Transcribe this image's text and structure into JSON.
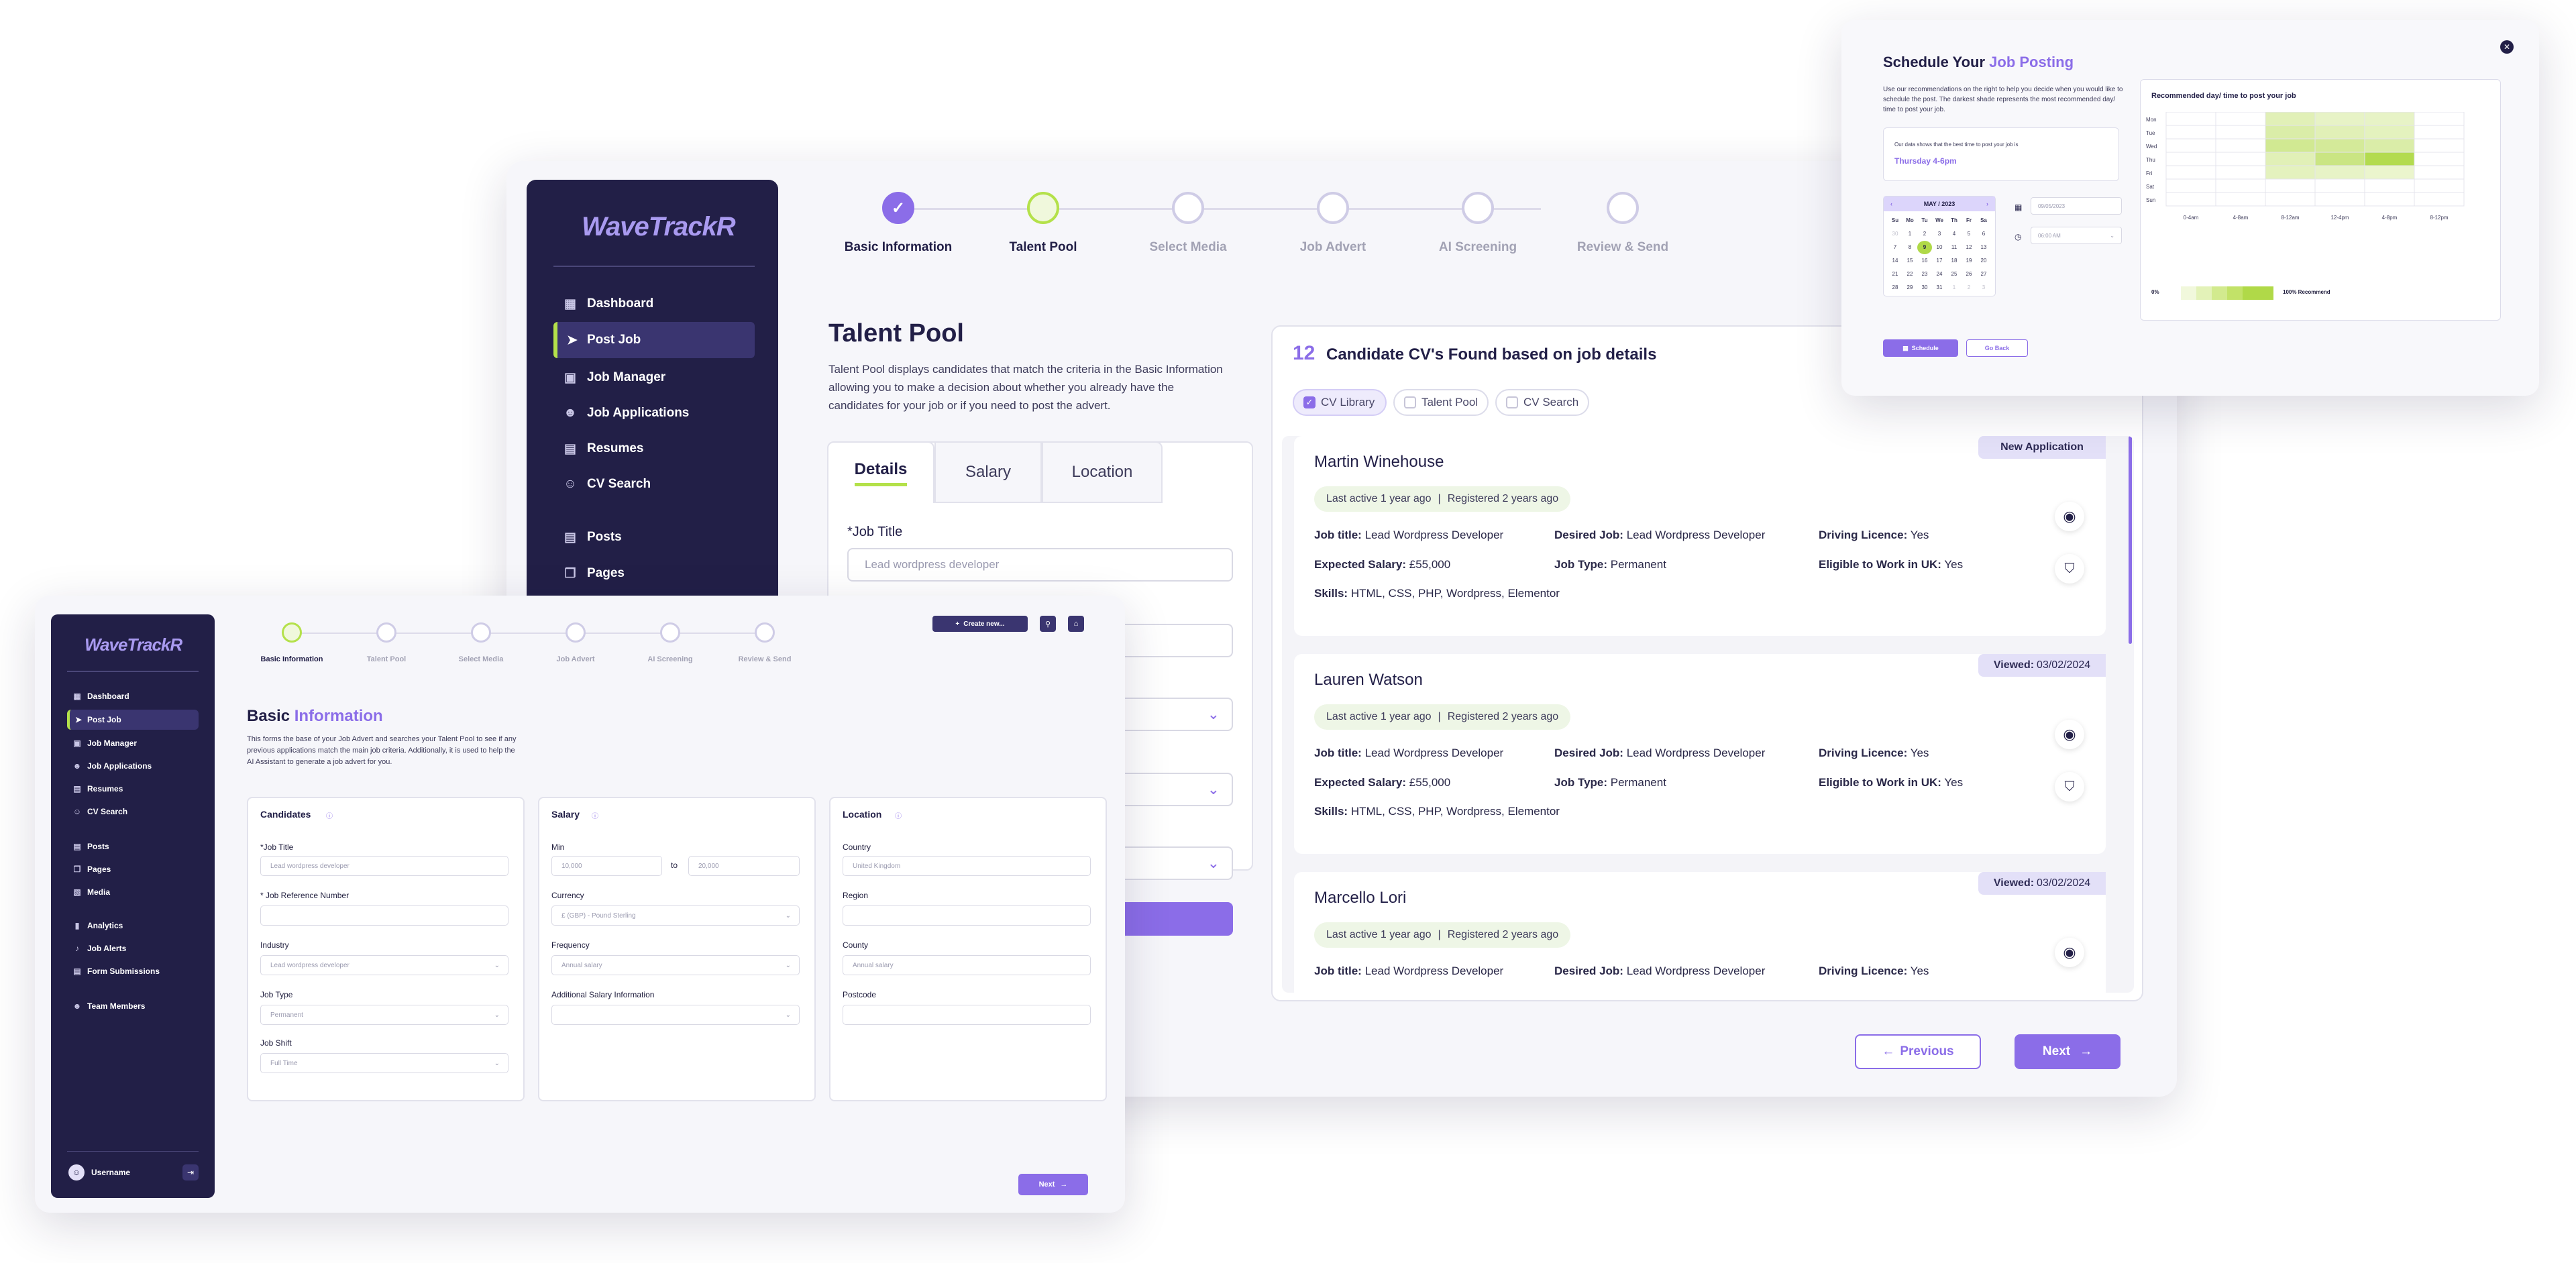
{
  "brand": {
    "logo": "WaveTrackR"
  },
  "steps": [
    "Basic Information",
    "Talent Pool",
    "Select Media",
    "Job Advert",
    "AI Screening",
    "Review & Send"
  ],
  "main": {
    "nav": [
      "Dashboard",
      "Post Job",
      "Job Manager",
      "Job Applications",
      "Resumes",
      "CV Search",
      "Posts",
      "Pages"
    ],
    "title": "Talent Pool",
    "description": "Talent Pool displays candidates that match the criteria in the Basic Information allowing you to make a decision about whether you already have the candidates for your job or if you need to post the advert.",
    "tabs": [
      "Details",
      "Salary",
      "Location"
    ],
    "job_title_label": "*Job Title",
    "job_title_placeholder": "Lead wordpress developer",
    "results_count": "12",
    "results_title": "Candidate CV's Found based on job details",
    "filters": [
      "CV Library",
      "Talent Pool",
      "CV Search"
    ],
    "candidates": [
      {
        "name": "Martin Winehouse",
        "badge": "New Application",
        "badge_prefix": "",
        "activity": "Last active 1 year ago",
        "registered": "Registered 2 years ago",
        "job_title_k": "Job title:",
        "job_title": "Lead Wordpress Developer",
        "desired_k": "Desired Job:",
        "desired": "Lead Wordpress Developer",
        "licence_k": "Driving Licence:",
        "licence": "Yes",
        "salary_k": "Expected Salary:",
        "salary": "£55,000",
        "type_k": "Job Type:",
        "type": "Permanent",
        "eligible_k": "Eligible to Work in UK:",
        "eligible": "Yes",
        "skills_k": "Skills:",
        "skills": "HTML, CSS, PHP, Wordpress, Elementor"
      },
      {
        "name": "Lauren Watson",
        "badge": "03/02/2024",
        "badge_prefix": "Viewed:",
        "activity": "Last active 1 year ago",
        "registered": "Registered 2 years ago",
        "job_title_k": "Job title:",
        "job_title": "Lead Wordpress Developer",
        "desired_k": "Desired Job:",
        "desired": "Lead Wordpress Developer",
        "licence_k": "Driving Licence:",
        "licence": "Yes",
        "salary_k": "Expected Salary:",
        "salary": "£55,000",
        "type_k": "Job Type:",
        "type": "Permanent",
        "eligible_k": "Eligible to Work in UK:",
        "eligible": "Yes",
        "skills_k": "Skills:",
        "skills": "HTML, CSS, PHP, Wordpress, Elementor"
      },
      {
        "name": "Marcello Lori",
        "badge": "03/02/2024",
        "badge_prefix": "Viewed:",
        "activity": "Last active 1 year ago",
        "registered": "Registered 2 years ago",
        "job_title_k": "Job title:",
        "job_title": "Lead Wordpress Developer",
        "desired_k": "Desired Job:",
        "desired": "Lead Wordpress Developer",
        "licence_k": "Driving Licence:",
        "licence": "Yes"
      }
    ],
    "prev": "Previous",
    "next": "Next"
  },
  "front": {
    "nav": [
      "Dashboard",
      "Post Job",
      "Job Manager",
      "Job Applications",
      "Resumes",
      "CV Search",
      "Posts",
      "Pages",
      "Media",
      "Analytics",
      "Job Alerts",
      "Form Submissions",
      "Team Members"
    ],
    "username": "Username",
    "create": "Create new...",
    "title_a": "Basic",
    "title_b": "Information",
    "description": "This forms the base of your Job Advert and searches your Talent Pool to see if any previous applications match the main job criteria. Additionally, it is used to help the AI Assistant to generate a job advert for you.",
    "candidates": {
      "title": "Candidates",
      "job_title": "*Job Title",
      "job_title_ph": "Lead wordpress developer",
      "ref": "* Job Reference Number",
      "industry": "Industry",
      "industry_ph": "Lead wordpress developer",
      "job_type": "Job Type",
      "job_type_val": "Permanent",
      "shift": "Job Shift",
      "shift_val": "Full Time"
    },
    "salary": {
      "title": "Salary",
      "min": "Min",
      "min_ph": "10,000",
      "to": "to",
      "max_ph": "20,000",
      "currency": "Currency",
      "currency_val": "£ (GBP) - Pound Sterling",
      "frequency": "Frequency",
      "frequency_ph": "Annual salary",
      "additional": "Additional Salary Information"
    },
    "location": {
      "title": "Location",
      "country": "Country",
      "country_ph": "United Kingdom",
      "region": "Region",
      "county": "County",
      "county_ph": "Annual salary",
      "postcode": "Postcode"
    },
    "next": "Next"
  },
  "schedule": {
    "title_a": "Schedule Your",
    "title_b": "Job Posting",
    "description": "Use our recommendations on the right to help you decide when you would like to schedule the post. The darkest shade represents the most recommended day/ time to post your job.",
    "best_note": "Our data shows that the best time to post your job is",
    "best_time": "Thursday 4-6pm",
    "month": "MAY / 2023",
    "weekdays": [
      "Su",
      "Mo",
      "Tu",
      "We",
      "Th",
      "Fr",
      "Sa"
    ],
    "days": [
      [
        "30",
        "1",
        "2",
        "3",
        "4",
        "5",
        "6"
      ],
      [
        "7",
        "8",
        "9",
        "10",
        "11",
        "12",
        "13"
      ],
      [
        "14",
        "15",
        "16",
        "17",
        "18",
        "19",
        "20"
      ],
      [
        "21",
        "22",
        "23",
        "24",
        "25",
        "26",
        "27"
      ],
      [
        "28",
        "29",
        "30",
        "31",
        "1",
        "2",
        "3"
      ]
    ],
    "date_ph": "09/05/2023",
    "time_ph": "06:00 AM",
    "chart_title": "Recommended day/ time to post your job",
    "chart_days": [
      "Mon",
      "Tue",
      "Wed",
      "Thu",
      "Fri",
      "Sat",
      "Sun"
    ],
    "chart_times": [
      "0-4am",
      "4-8am",
      "8-12am",
      "12-4pm",
      "4-8pm",
      "8-12pm"
    ],
    "legend_min": "0%",
    "legend_max": "100% Recommend",
    "schedule_btn": "Schedule",
    "back_btn": "Go Back"
  },
  "chart_data": {
    "type": "heatmap",
    "title": "Recommended day/ time to post your job",
    "rows": [
      "Mon",
      "Tue",
      "Wed",
      "Thu",
      "Fri",
      "Sat",
      "Sun"
    ],
    "cols": [
      "0-4am",
      "4-8am",
      "8-12am",
      "12-4pm",
      "4-8pm",
      "8-12pm"
    ],
    "values": [
      [
        0,
        0,
        0.25,
        0.15,
        0.15,
        0
      ],
      [
        0,
        0,
        0.35,
        0.25,
        0.2,
        0
      ],
      [
        0,
        0,
        0.5,
        0.45,
        0.35,
        0
      ],
      [
        0,
        0,
        0.25,
        0.6,
        0.95,
        0
      ],
      [
        0,
        0,
        0.2,
        0.15,
        0.1,
        0
      ],
      [
        0,
        0,
        0,
        0,
        0,
        0
      ],
      [
        0,
        0,
        0,
        0,
        0,
        0
      ]
    ],
    "legend": [
      "0%",
      "100% Recommend"
    ]
  }
}
